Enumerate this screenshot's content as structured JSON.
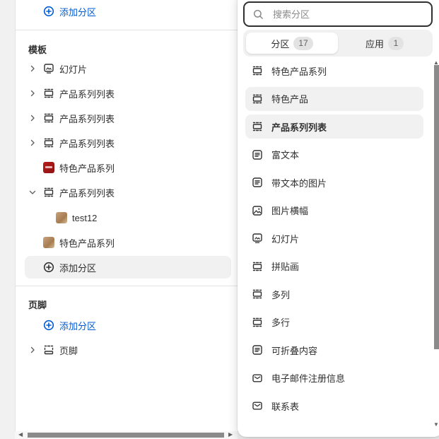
{
  "sidebar": {
    "top_add": {
      "label": "添加分区",
      "icon": "plus-circle-icon"
    },
    "template": {
      "heading": "模板",
      "items": [
        {
          "label": "幻灯片",
          "icon": "slideshow-icon",
          "expandable": true
        },
        {
          "label": "产品系列列表",
          "icon": "section-icon",
          "expandable": true
        },
        {
          "label": "产品系列列表",
          "icon": "section-icon",
          "expandable": true
        },
        {
          "label": "产品系列列表",
          "icon": "section-icon",
          "expandable": true
        },
        {
          "label": "特色产品系列",
          "icon": "image-thumbnail-red",
          "expandable": false
        },
        {
          "label": "产品系列列表",
          "icon": "section-icon",
          "expanded": true
        },
        {
          "label": "test12",
          "icon": "image-thumbnail-tan",
          "child": true
        },
        {
          "label": "特色产品系列",
          "icon": "image-thumbnail-tan",
          "expandable": false
        }
      ],
      "add_label": "添加分区"
    },
    "footer": {
      "heading": "页脚",
      "add_label": "添加分区",
      "item_label": "页脚"
    }
  },
  "popover": {
    "search": {
      "placeholder": "搜索分区",
      "value": ""
    },
    "tabs": [
      {
        "label": "分区",
        "count": "17",
        "active": true
      },
      {
        "label": "应用",
        "count": "1",
        "active": false
      }
    ],
    "items": [
      {
        "label": "特色产品系列",
        "icon": "section-icon"
      },
      {
        "label": "特色产品",
        "icon": "section-icon",
        "state": "hover"
      },
      {
        "label": "产品系列列表",
        "icon": "section-icon",
        "state": "selected"
      },
      {
        "label": "富文本",
        "icon": "text-block-icon"
      },
      {
        "label": "带文本的图片",
        "icon": "text-block-icon"
      },
      {
        "label": "图片横幅",
        "icon": "image-icon"
      },
      {
        "label": "幻灯片",
        "icon": "slideshow-icon"
      },
      {
        "label": "拼贴画",
        "icon": "section-icon"
      },
      {
        "label": "多列",
        "icon": "section-icon"
      },
      {
        "label": "多行",
        "icon": "section-icon"
      },
      {
        "label": "可折叠内容",
        "icon": "text-block-icon"
      },
      {
        "label": "电子邮件注册信息",
        "icon": "email-icon"
      },
      {
        "label": "联系表",
        "icon": "email-icon"
      }
    ]
  },
  "colors": {
    "accent": "#005bd3",
    "text": "#303030",
    "muted": "#616161",
    "hover": "#f1f1f1"
  }
}
